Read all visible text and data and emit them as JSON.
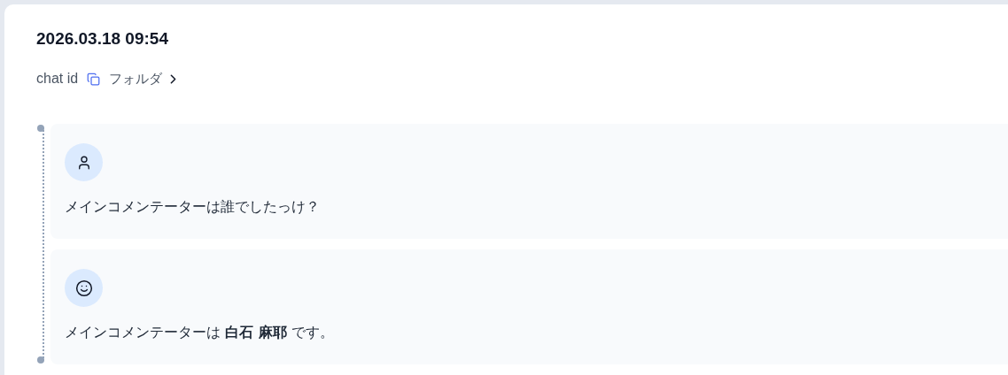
{
  "header": {
    "title": "2026.03.18 09:54",
    "chat_id_label": "chat id",
    "folder_link": "フォルダ"
  },
  "messages": [
    {
      "kind": "user",
      "text": "メインコメンテーターは誰でしたっけ？"
    },
    {
      "kind": "assistant",
      "text": "メインコメンテーターは **白石 麻耶** です。"
    }
  ]
}
